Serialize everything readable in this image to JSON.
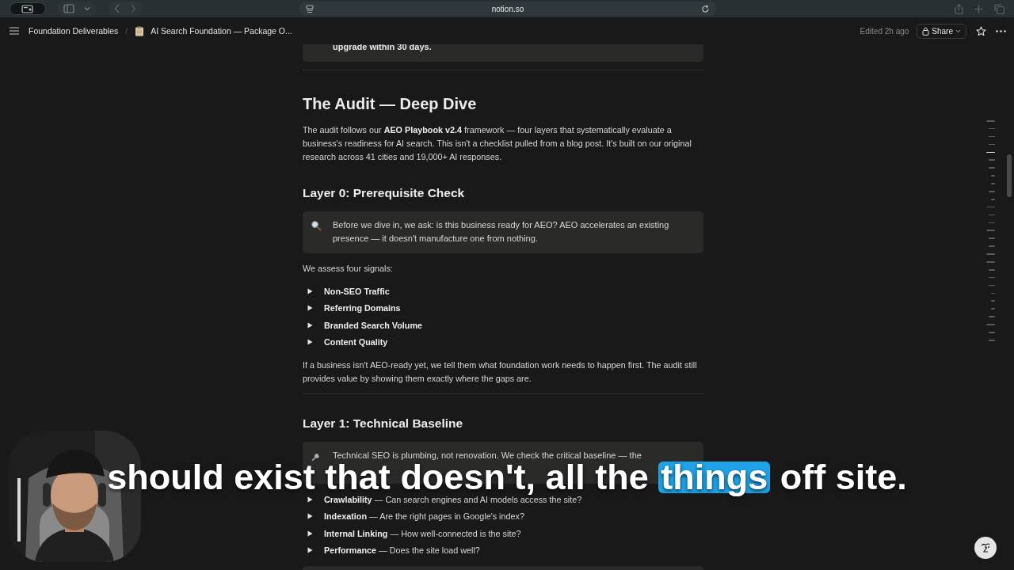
{
  "browser": {
    "url": "notion.so"
  },
  "header": {
    "breadcrumbs": [
      {
        "label": "Foundation Deliverables"
      },
      {
        "label": "AI Search Foundation — Package O..."
      }
    ],
    "separator": "/",
    "edited": "Edited 2h ago",
    "share": "Share"
  },
  "blocks": [
    {
      "kind": "callout",
      "text": "upgrade within 30 days.",
      "bold": true
    },
    {
      "kind": "divider"
    },
    {
      "kind": "heading1",
      "text": "The Audit — Deep Dive"
    },
    {
      "kind": "paragraph",
      "text": "The audit follows our **AEO Playbook v2.4** framework — four layers that systematically evaluate a business's readiness for AI search. This isn't a checklist pulled from a blog post. It's built on our original research across 41 cities and 19,000+ AI responses."
    },
    {
      "kind": "heading2",
      "text": "Layer 0: Prerequisite Check"
    },
    {
      "kind": "callout",
      "text": "Before we dive in, we ask: is this business ready for AEO? AEO accelerates an existing presence — it doesn't manufacture one from nothing.",
      "bold": false
    },
    {
      "kind": "paragraph",
      "text": "We assess four signals:"
    },
    {
      "kind": "toggle_list",
      "items": [
        {
          "title": "Non-SEO Traffic",
          "expanded": false
        },
        {
          "title": "Referring Domains",
          "expanded": false
        },
        {
          "title": "Branded Search Volume",
          "expanded": false
        },
        {
          "title": "Content Quality",
          "expanded": false
        }
      ]
    },
    {
      "kind": "paragraph",
      "text": "If a business isn't AEO-ready yet, we tell them what foundation work needs to happen first. The audit still provides value by showing them exactly where the gaps are."
    },
    {
      "kind": "divider"
    },
    {
      "kind": "heading2",
      "text": "Layer 1: Technical Baseline"
    },
    {
      "kind": "callout",
      "text": "Technical SEO is plumbing, not renovation. We check the critical baseline — the",
      "bold": false
    },
    {
      "kind": "toggle_list",
      "items": [
        {
          "title": "Crawlability",
          "detail": "— Can search engines and AI models access the site?",
          "expanded": false
        },
        {
          "title": "Indexation",
          "detail": "— Are the right pages in Google's index?",
          "expanded": false
        },
        {
          "title": "Internal Linking",
          "detail": "— How well-connected is the site?",
          "expanded": false
        },
        {
          "title": "Performance",
          "detail": "— Does the site load well?",
          "expanded": false
        }
      ]
    },
    {
      "kind": "callout"
    }
  ],
  "caption": {
    "words": [
      {
        "text": "should",
        "highlighted": false
      },
      {
        "text": "exist",
        "highlighted": false
      },
      {
        "text": "that",
        "highlighted": false
      },
      {
        "text": "doesn't,",
        "highlighted": false
      },
      {
        "text": "all",
        "highlighted": false
      },
      {
        "text": "the",
        "highlighted": false
      },
      {
        "text": "things",
        "highlighted": true
      },
      {
        "text": "off",
        "highlighted": false
      },
      {
        "text": "site.",
        "highlighted": false
      }
    ]
  }
}
